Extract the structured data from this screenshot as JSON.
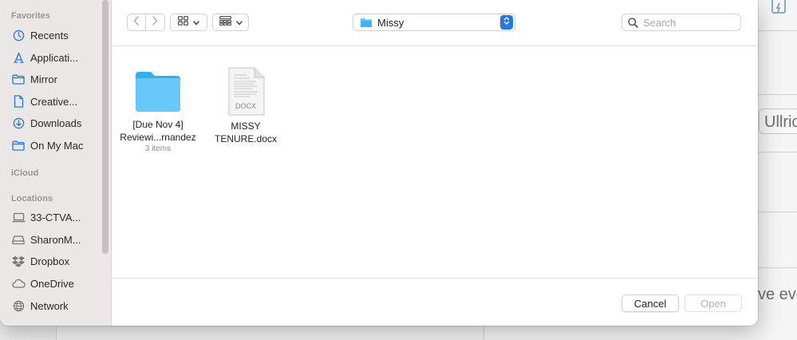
{
  "background": {
    "text_1": "Ullric",
    "text_2": "ve eve"
  },
  "sidebar": {
    "sections": {
      "favorites": "Favorites",
      "icloud": "iCloud",
      "locations": "Locations"
    },
    "favorites": [
      {
        "label": "Recents",
        "icon": "clock-icon"
      },
      {
        "label": "Applicati...",
        "icon": "applications-icon"
      },
      {
        "label": "Mirror",
        "icon": "folder-icon"
      },
      {
        "label": "Creative...",
        "icon": "document-icon"
      },
      {
        "label": "Downloads",
        "icon": "download-icon"
      },
      {
        "label": "On My Mac",
        "icon": "folder-icon"
      }
    ],
    "locations": [
      {
        "label": "33-CTVA...",
        "icon": "laptop-icon"
      },
      {
        "label": "SharonM...",
        "icon": "drive-icon"
      },
      {
        "label": "Dropbox",
        "icon": "dropbox-icon"
      },
      {
        "label": "OneDrive",
        "icon": "cloud-icon"
      },
      {
        "label": "Network",
        "icon": "globe-icon"
      }
    ]
  },
  "toolbar": {
    "current_folder": "Missy",
    "search_placeholder": "Search"
  },
  "files": [
    {
      "name_line1": "[Due Nov 4]",
      "name_line2": "Reviewi...rnandez",
      "sub": "3 items",
      "type": "folder"
    },
    {
      "name_line1": "MISSY",
      "name_line2": "TENURE.docx",
      "sub": "",
      "type": "docx",
      "badge": "DOCX"
    }
  ],
  "footer": {
    "cancel_label": "Cancel",
    "open_label": "Open"
  },
  "colors": {
    "accent": "#2a76df",
    "folder": "#5ac8fa",
    "sidebar_icon": "#2a76df"
  }
}
